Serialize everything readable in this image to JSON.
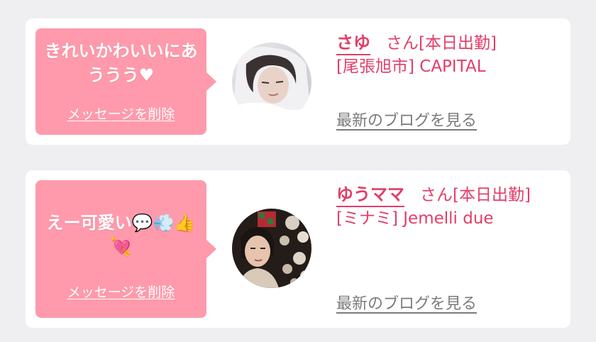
{
  "cards": [
    {
      "message": "きれいかわいいにあううう♥",
      "delete_label": "メッセージを削除",
      "name": "さゆ",
      "honorific_status": "さん[本日出勤]",
      "area_shop": "[尾張旭市] CAPITAL",
      "blog_label": "最新のブログを見る"
    },
    {
      "message": "えー可愛い💬💨👍💘",
      "delete_label": "メッセージを削除",
      "name": "ゆうママ",
      "honorific_status": "さん[本日出勤]",
      "area_shop": "[ミナミ] Jemelli due",
      "blog_label": "最新のブログを見る"
    }
  ],
  "colors": {
    "background": "#efeff1",
    "bubble": "#fe9aab",
    "accent": "#e33d68",
    "link_gray": "#7b7b7b"
  }
}
